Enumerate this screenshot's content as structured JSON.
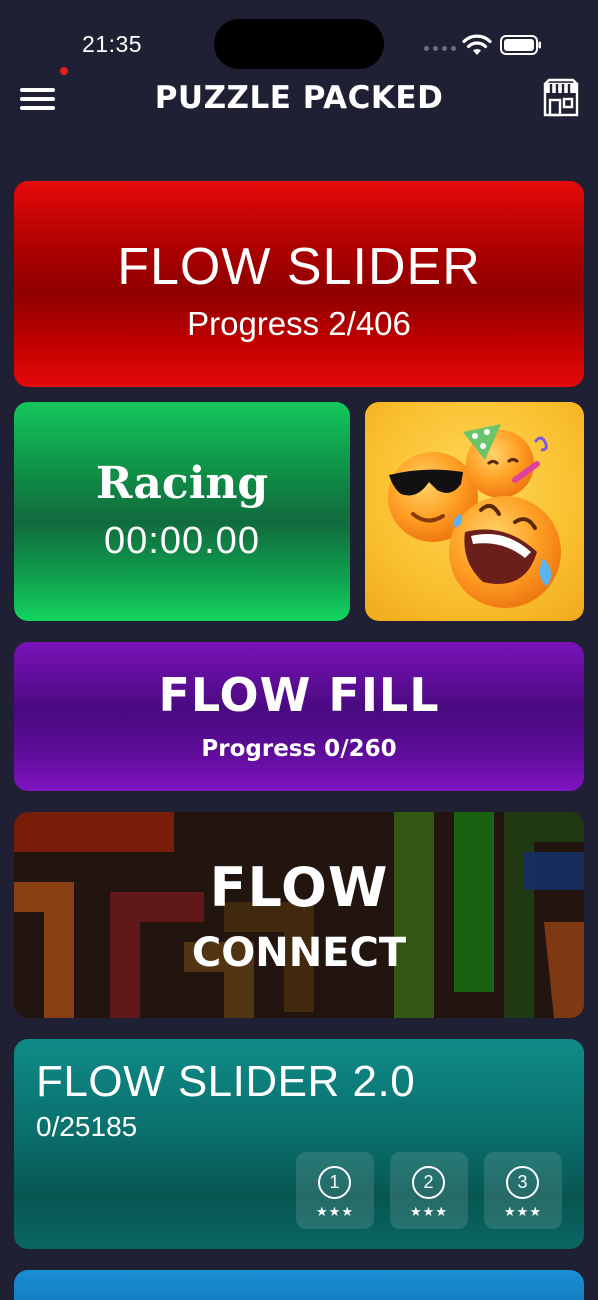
{
  "status_bar": {
    "time": "21:35"
  },
  "header": {
    "title": "PUZZLE PACKED",
    "menu_icon": "hamburger-menu-icon",
    "shop_icon": "store-icon"
  },
  "cards": {
    "flow_slider": {
      "title": "FLOW SLIDER",
      "progress": "Progress 2/406"
    },
    "racing": {
      "title": "Racing",
      "timer": "00:00.00"
    },
    "flow_fill": {
      "title": "FLOW FILL",
      "progress": "Progress 0/260"
    },
    "flow_connect": {
      "title_line1": "FLOW",
      "title_line2": "CONNECT"
    },
    "flow_slider_2": {
      "title": "FLOW SLIDER 2.0",
      "progress": "0/25185",
      "levels": [
        {
          "number": "1",
          "stars": "★★★"
        },
        {
          "number": "2",
          "stars": "★★★"
        },
        {
          "number": "3",
          "stars": "★★★"
        }
      ]
    }
  },
  "colors": {
    "background": "#1f2033",
    "slider_red": "#c40000",
    "racing_green": "#12c75c",
    "fill_purple": "#6a10a8",
    "slider2_teal": "#0a6f6c",
    "notification": "#e61f1f"
  }
}
